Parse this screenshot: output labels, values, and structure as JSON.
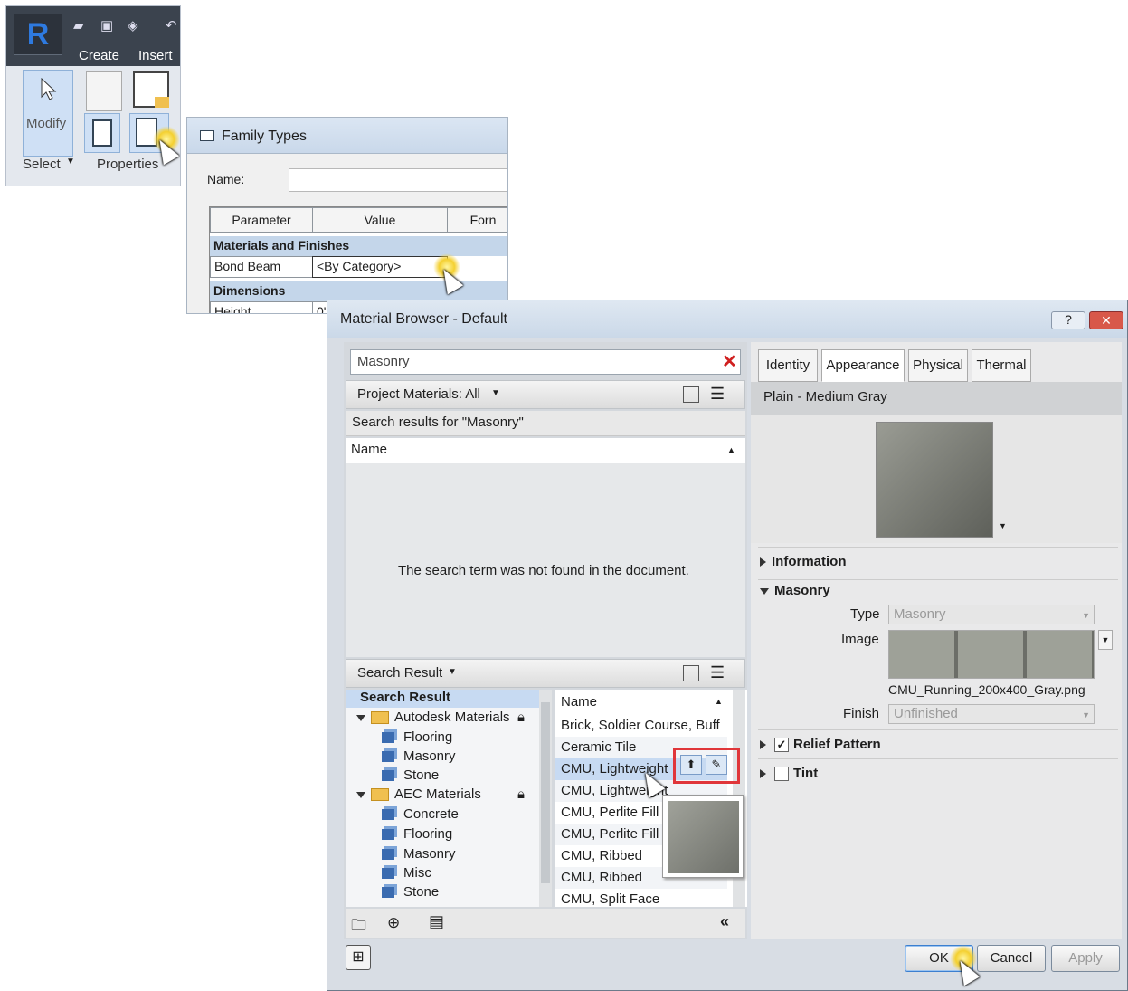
{
  "ribbon": {
    "tabs": [
      "Create",
      "Insert"
    ],
    "modify_label": "Modify",
    "select_label": "Select",
    "properties_label": "Properties",
    "app_logo": "R"
  },
  "family_types": {
    "title": "Family Types",
    "name_label": "Name:",
    "columns": [
      "Parameter",
      "Value",
      "Forn"
    ],
    "groups": [
      "Materials and Finishes",
      "Dimensions"
    ],
    "rows": [
      {
        "param": "Bond Beam",
        "value": "<By Category>"
      },
      {
        "param": "Height",
        "value": "0'"
      }
    ]
  },
  "material_browser": {
    "title": "Material Browser - Default",
    "help": "?",
    "search_value": "Masonry",
    "filter_label": "Project Materials: All",
    "search_results_label": "Search results for \"Masonry\"",
    "name_header": "Name",
    "not_found_message": "The search term was not found in the document.",
    "library_filter_label": "Search Result",
    "tree": [
      {
        "label": "Search Result",
        "level": 0,
        "kind": "header"
      },
      {
        "label": "Autodesk Materials",
        "level": 1,
        "kind": "folder",
        "locked": true
      },
      {
        "label": "Flooring",
        "level": 2,
        "kind": "lib"
      },
      {
        "label": "Masonry",
        "level": 2,
        "kind": "lib"
      },
      {
        "label": "Stone",
        "level": 2,
        "kind": "lib"
      },
      {
        "label": "AEC Materials",
        "level": 1,
        "kind": "folder",
        "locked": true
      },
      {
        "label": "Concrete",
        "level": 2,
        "kind": "lib"
      },
      {
        "label": "Flooring",
        "level": 2,
        "kind": "lib"
      },
      {
        "label": "Masonry",
        "level": 2,
        "kind": "lib"
      },
      {
        "label": "Misc",
        "level": 2,
        "kind": "lib"
      },
      {
        "label": "Stone",
        "level": 2,
        "kind": "lib"
      }
    ],
    "library_list_header": "Name",
    "library_items": [
      "Brick, Soldier Course, Buff",
      "Ceramic Tile",
      "CMU, Lightweight",
      "CMU, Lightweight",
      "CMU, Perlite Fill",
      "CMU, Perlite Fill",
      "CMU, Ribbed",
      "CMU, Ribbed",
      "CMU, Split Face"
    ],
    "tabs": [
      "Identity",
      "Appearance",
      "Physical",
      "Thermal"
    ],
    "active_tab": "Appearance",
    "asset_name": "Plain - Medium Gray",
    "sections": {
      "information": "Information",
      "masonry": "Masonry",
      "relief": "Relief Pattern",
      "tint": "Tint"
    },
    "props": {
      "type_label": "Type",
      "type_value": "Masonry",
      "image_label": "Image",
      "image_file": "CMU_Running_200x400_Gray.png",
      "finish_label": "Finish",
      "finish_value": "Unfinished"
    },
    "relief_checked": true,
    "tint_checked": false,
    "buttons": {
      "ok": "OK",
      "cancel": "Cancel",
      "apply": "Apply"
    },
    "colors": {
      "highlight_box": "#e0363a",
      "selection": "#c7daf2",
      "title_bar": "#cad8e8"
    }
  }
}
